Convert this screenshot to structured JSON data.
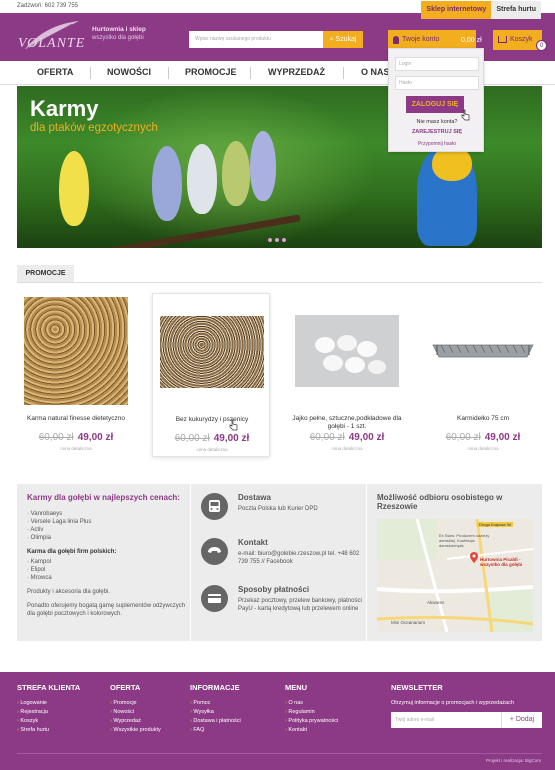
{
  "topbar": {
    "phone": "Zadzwoń: 602 739 755"
  },
  "shop_tabs": {
    "retail": "Sklep internetowy",
    "wholesale": "Strefa hurtu"
  },
  "header": {
    "logo_text": "VOLANTE",
    "tagline_title": "Hurtownia i sklep",
    "tagline_sub": "wszystko dla gołębi",
    "search_placeholder": "Wpisz nazwę szukanego produktu",
    "search_button": "Szukaj",
    "account_label": "Twoje konto",
    "cart_total": "0,00 zł",
    "cart_label": "Koszyk",
    "cart_count": "0"
  },
  "nav": {
    "items": [
      "OFERTA",
      "NOWOŚCI",
      "PROMOCJE",
      "WYPRZEDAŻ",
      "O NAS"
    ]
  },
  "login": {
    "login_placeholder": "Login",
    "password_placeholder": "Hasło",
    "submit": "ZALOGUJ SIĘ",
    "no_account": "Nie masz konta?",
    "register": "ZAREJESTRUJ SIĘ",
    "remind": "Przypomnij hasło"
  },
  "banner": {
    "title": "Karmy",
    "subtitle": "dla ptaków egzotycznych"
  },
  "promo": {
    "heading": "PROMOCJE"
  },
  "products": [
    {
      "name": "Karma natural finesse dietetyczno",
      "old_price": "60,00 zł",
      "price": "49,00 zł",
      "note": "cena detaliczna"
    },
    {
      "name": "Bez kukurydzy i pszenicy",
      "old_price": "60,00 zł",
      "price": "49,00 zł",
      "note": "cena detaliczna"
    },
    {
      "name": "Jajko pełne, sztuczne,podkładowe dla gołębi - 1 szt.",
      "old_price": "60,00 zł",
      "price": "49,00 zł",
      "note": "cena detaliczna"
    },
    {
      "name": "Karmidełko 75 cm",
      "old_price": "60,00 zł",
      "price": "49,00 zł",
      "note": "cena detaliczna"
    }
  ],
  "info": {
    "feed_title": "Karmy dla gołębi w najlepszych cenach:",
    "feed_list": [
      "Vanrobaeys",
      "Versele Laga linia Plus",
      "Activ",
      "Olimpia"
    ],
    "polish_title": "Karma dla gołębi firm polskich:",
    "polish_list": [
      "Kampol",
      "Elipol",
      "Mrowca"
    ],
    "accessories": "Produkty i akcesoria dla gołębi.",
    "supplements": "Ponadto oferujemy bogatą gamę suplementów odżywczych dla gołębi pocztowych i kolorowych.",
    "delivery_title": "Dostawa",
    "delivery_text": "Poczta Polska lub Kurier DPD",
    "contact_title": "Kontakt",
    "contact_text": "e-mail: biuro@golebie.rzeszow.pl tel. +48 602 739 755 // Facebook",
    "payment_title": "Sposoby płatności",
    "payment_text": "Przekaz pocztowy, przelew bankowy, płatności PayU - kartą kredytową lub przelewem online",
    "pickup_title": "Możliwość odbioru osobistego w Rzeszowie",
    "map_pin_label": "Hurtownia Picaldi - wszystko dla gołębi",
    "map_streets": [
      "Droga Krajowa 94",
      "Akwares",
      "Mini Oceanarium",
      "Ex Stars: Producent odzieży damskiej. Konfekcja damska/męsk"
    ]
  },
  "footer": {
    "client_title": "STREFA KLIENTA",
    "client_items": [
      "Logowanie",
      "Rejestracja",
      "Koszyk",
      "Strefa hurtu"
    ],
    "offer_title": "OFERTA",
    "offer_items": [
      "Promocje",
      "Nowości",
      "Wyprzedaż",
      "Wszystkie produkty"
    ],
    "info_title": "INFORMACJE",
    "info_items": [
      "Pomoc",
      "Wysyłka",
      "Dostawa i płatności",
      "FAQ"
    ],
    "menu_title": "MENU",
    "menu_items": [
      "O nas",
      "Regulamin",
      "Polityka prywatności",
      "Kontakt"
    ],
    "newsletter_title": "NEWSLETTER",
    "newsletter_text": "Otrzymuj informacje o promocjach i wyprzedażach",
    "newsletter_placeholder": "Twój adres e-mail",
    "newsletter_button": "+ Dodaj",
    "credit": "Projekt i realizacja: BigCom"
  },
  "colors": {
    "brand": "#8d3a86",
    "accent": "#f2ae1f"
  }
}
